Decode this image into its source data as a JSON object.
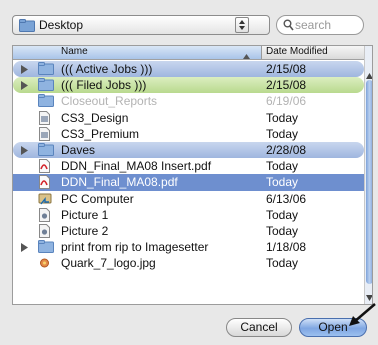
{
  "location": {
    "label": "Desktop"
  },
  "search": {
    "placeholder": "search"
  },
  "columns": {
    "name": "Name",
    "date": "Date Modified"
  },
  "rows": [
    {
      "name": "((( Active Jobs )))",
      "date": "2/15/08",
      "style": "blue",
      "disclosure": true,
      "icon": "folder-icon"
    },
    {
      "name": "((( Filed Jobs )))",
      "date": "2/15/08",
      "style": "green",
      "disclosure": true,
      "icon": "folder-icon"
    },
    {
      "name": "Closeout_Reports",
      "date": "6/19/06",
      "style": "dim",
      "disclosure": false,
      "icon": "folder-icon"
    },
    {
      "name": "CS3_Design",
      "date": "Today",
      "style": "",
      "disclosure": false,
      "icon": "document-icon"
    },
    {
      "name": "CS3_Premium",
      "date": "Today",
      "style": "",
      "disclosure": false,
      "icon": "document-icon"
    },
    {
      "name": "Daves",
      "date": "2/28/08",
      "style": "blue",
      "disclosure": true,
      "icon": "folder-icon"
    },
    {
      "name": "DDN_Final_MA08 Insert.pdf",
      "date": "Today",
      "style": "",
      "disclosure": false,
      "icon": "pdf-icon"
    },
    {
      "name": "DDN_Final_MA08.pdf",
      "date": "Today",
      "style": "sel",
      "disclosure": false,
      "icon": "pdf-icon"
    },
    {
      "name": "PC Computer",
      "date": "6/13/06",
      "style": "",
      "disclosure": false,
      "icon": "alias-icon"
    },
    {
      "name": "Picture 1",
      "date": "Today",
      "style": "",
      "disclosure": false,
      "icon": "image-icon"
    },
    {
      "name": "Picture 2",
      "date": "Today",
      "style": "",
      "disclosure": false,
      "icon": "image-icon"
    },
    {
      "name": "print from rip to Imagesetter",
      "date": "1/18/08",
      "style": "",
      "disclosure": true,
      "icon": "folder-icon"
    },
    {
      "name": "Quark_7_logo.jpg",
      "date": "Today",
      "style": "",
      "disclosure": false,
      "icon": "jpg-icon"
    }
  ],
  "buttons": {
    "cancel": "Cancel",
    "open": "Open"
  },
  "colors": {
    "selection": "#6e8fcf",
    "label_blue": "#a9c0e6",
    "label_green": "#c6e3a1",
    "default_button": "#7fa6e2"
  }
}
